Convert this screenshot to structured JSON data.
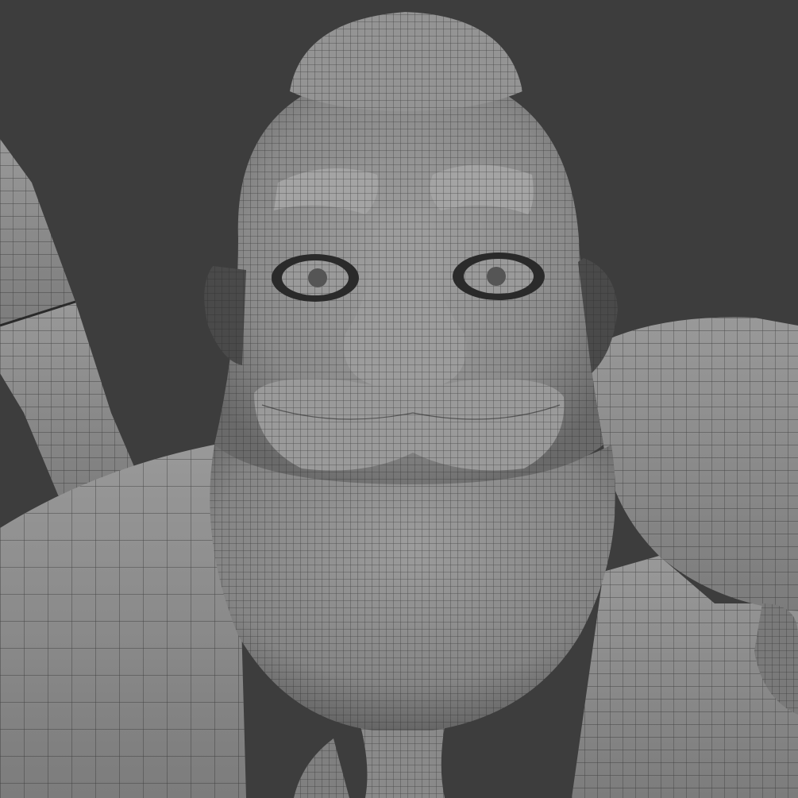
{
  "scene": {
    "background_color": "#3d3d3d",
    "mesh_fill_color": "#8e8e8e",
    "mesh_shadow_color": "#5f5f5f",
    "wire_color": "#2a2a2a",
    "highlight_color": "#a9a9a9",
    "subject": "wireframe-character-head-bust"
  }
}
